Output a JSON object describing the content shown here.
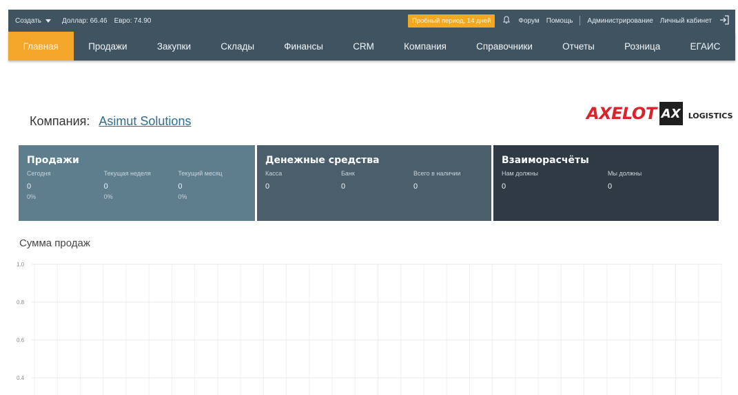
{
  "topbar": {
    "create_label": "Создать",
    "usd_rate": "Доллар: 66.46",
    "eur_rate": "Евро: 74.90",
    "trial_label": "Пробный период, 14 дней",
    "forum_label": "Форум",
    "help_label": "Помощь",
    "admin_label": "Администрирование",
    "cabinet_label": "Личный кабинет"
  },
  "nav": {
    "items": [
      {
        "label": "Главная"
      },
      {
        "label": "Продажи"
      },
      {
        "label": "Закупки"
      },
      {
        "label": "Склады"
      },
      {
        "label": "Финансы"
      },
      {
        "label": "CRM"
      },
      {
        "label": "Компания"
      },
      {
        "label": "Справочники"
      },
      {
        "label": "Отчеты"
      },
      {
        "label": "Розница"
      },
      {
        "label": "ЕГАИС"
      }
    ]
  },
  "company": {
    "label": "Компания:",
    "name": "Asimut Solutions"
  },
  "logo": {
    "brand": "AXELOT",
    "mark": "AX",
    "suffix": "LOGISTICS"
  },
  "cards": {
    "sales": {
      "title": "Продажи",
      "cols": [
        {
          "caption": "Сегодня",
          "value": "0",
          "pct": "0%"
        },
        {
          "caption": "Текущая неделя",
          "value": "0",
          "pct": "0%"
        },
        {
          "caption": "Текущий месяц",
          "value": "0",
          "pct": "0%"
        }
      ]
    },
    "money": {
      "title": "Денежные средства",
      "cols": [
        {
          "caption": "Касса",
          "value": "0"
        },
        {
          "caption": "Банк",
          "value": "0"
        },
        {
          "caption": "Всего в наличии",
          "value": "0"
        }
      ]
    },
    "settlements": {
      "title": "Взаиморасчёты",
      "cols": [
        {
          "caption": "Нам должны",
          "value": "0"
        },
        {
          "caption": "Мы должны",
          "value": "0"
        }
      ]
    }
  },
  "colors": {
    "nav_bg": "#3f5361",
    "accent": "#f4a62a",
    "card_sales": "#5e7e8e",
    "card_money": "#4b5e6c",
    "card_settle": "#2f3a44",
    "link": "#2f6c8e"
  },
  "chart_title": "Сумма продаж",
  "chart_data": {
    "type": "line",
    "title": "",
    "xlabel": "",
    "ylabel": "",
    "yticks": [
      "1.0",
      "0.8",
      "0.6",
      "0.4"
    ],
    "ylim": [
      0.4,
      1.0
    ],
    "grid": true,
    "series": []
  }
}
